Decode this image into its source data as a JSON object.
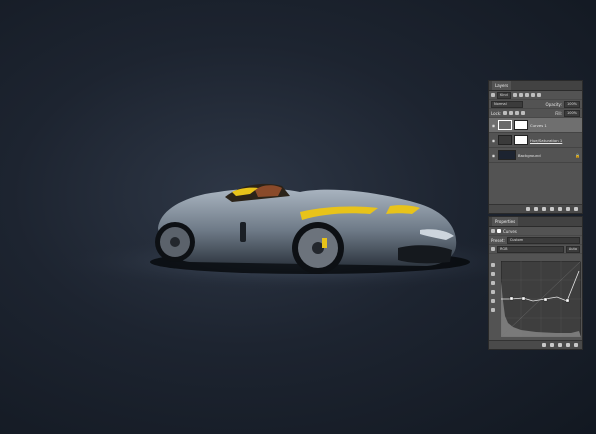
{
  "layers_panel": {
    "tab_label": "Layers",
    "kind_filter": "Kind",
    "blend_mode": "Normal",
    "opacity_label": "Opacity:",
    "opacity_value": "100%",
    "lock_label": "Lock:",
    "fill_label": "Fill:",
    "fill_value": "100%",
    "layers": [
      {
        "name": "Curves 1",
        "selected": true,
        "visible": true
      },
      {
        "name": "Hue/Saturation 1",
        "selected": false,
        "visible": true
      },
      {
        "name": "Background",
        "selected": false,
        "visible": true,
        "locked": true
      }
    ]
  },
  "properties_panel": {
    "tab_label": "Properties",
    "adjustment_name": "Curves",
    "preset_label": "Preset:",
    "preset_value": "Custom",
    "channel_value": "RGB",
    "auto_label": "Auto"
  },
  "colors": {
    "panel_bg": "#535353",
    "accent_yellow": "#e8c31a",
    "car_body": "#8a96a3"
  }
}
